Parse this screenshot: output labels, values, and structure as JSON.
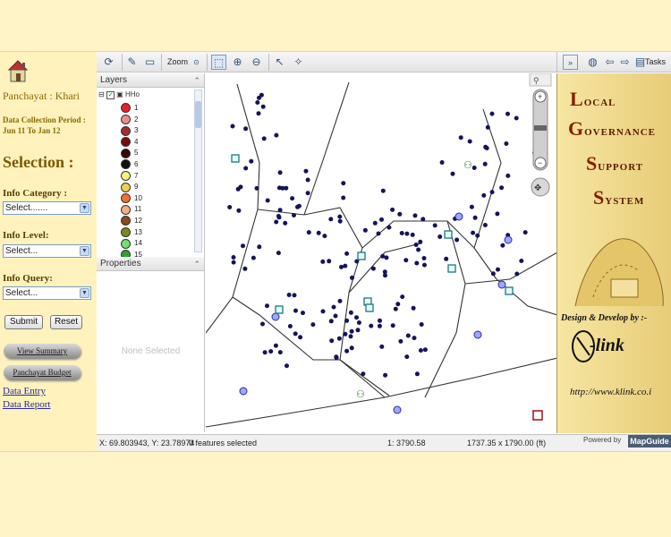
{
  "sidebar": {
    "panchayat": "Panchayat : Khari",
    "period_label": "Data Collection Period :",
    "period_value": "Jun 11 To Jan 12",
    "selection_heading": "Selection :",
    "info_category_label": "Info Category :",
    "info_category_value": "Select.......",
    "info_level_label": "Info Level:",
    "info_level_value": "Select...",
    "info_query_label": "Info Query:",
    "info_query_value": "Select...",
    "submit_label": "Submit",
    "reset_label": "Reset",
    "view_summary_label": "View Summary",
    "panchayat_budget_label": "Panchayat Budget",
    "data_entry_label": "Data Entry",
    "data_report_label": "Data Report"
  },
  "toolbar": {
    "zoom_label": "Zoom",
    "tasks_label": "Tasks"
  },
  "layers_panel": {
    "title": "Layers",
    "root_label": "HHo",
    "items": [
      {
        "label": "1",
        "color": "#e8202a"
      },
      {
        "label": "2",
        "color": "#f08a8a"
      },
      {
        "label": "3",
        "color": "#a03030"
      },
      {
        "label": "4",
        "color": "#7a0a0a"
      },
      {
        "label": "5",
        "color": "#3a0505"
      },
      {
        "label": "6",
        "color": "#111111"
      },
      {
        "label": "7",
        "color": "#f4f47a"
      },
      {
        "label": "9",
        "color": "#f0d050"
      },
      {
        "label": "10",
        "color": "#f07030"
      },
      {
        "label": "11",
        "color": "#f0b080"
      },
      {
        "label": "12",
        "color": "#8a4a1a"
      },
      {
        "label": "13",
        "color": "#7a8a20"
      },
      {
        "label": "14",
        "color": "#70e070"
      },
      {
        "label": "15",
        "color": "#30a030"
      }
    ]
  },
  "properties_panel": {
    "title": "Properties",
    "empty_text": "None Selected"
  },
  "statusbar": {
    "coords": "X: 69.803943, Y: 23.78974",
    "features": "0 features selected",
    "scale": "1: 3790.58",
    "size": "1737.35 x 1790.00 (ft)"
  },
  "branding": {
    "title_word1": "ocal",
    "title_word1_initial": "L",
    "title_word2": "overnance",
    "title_word2_initial": "G",
    "title_word3": "upport",
    "title_word3_initial": "S",
    "title_word4": "ystem",
    "title_word4_initial": "S",
    "design_text": "Design & Develop by :-",
    "company_text": "-link",
    "url_text": "http://www.klink.co.i",
    "powered_by": "Powered by",
    "mapguide": "MapGuide"
  }
}
